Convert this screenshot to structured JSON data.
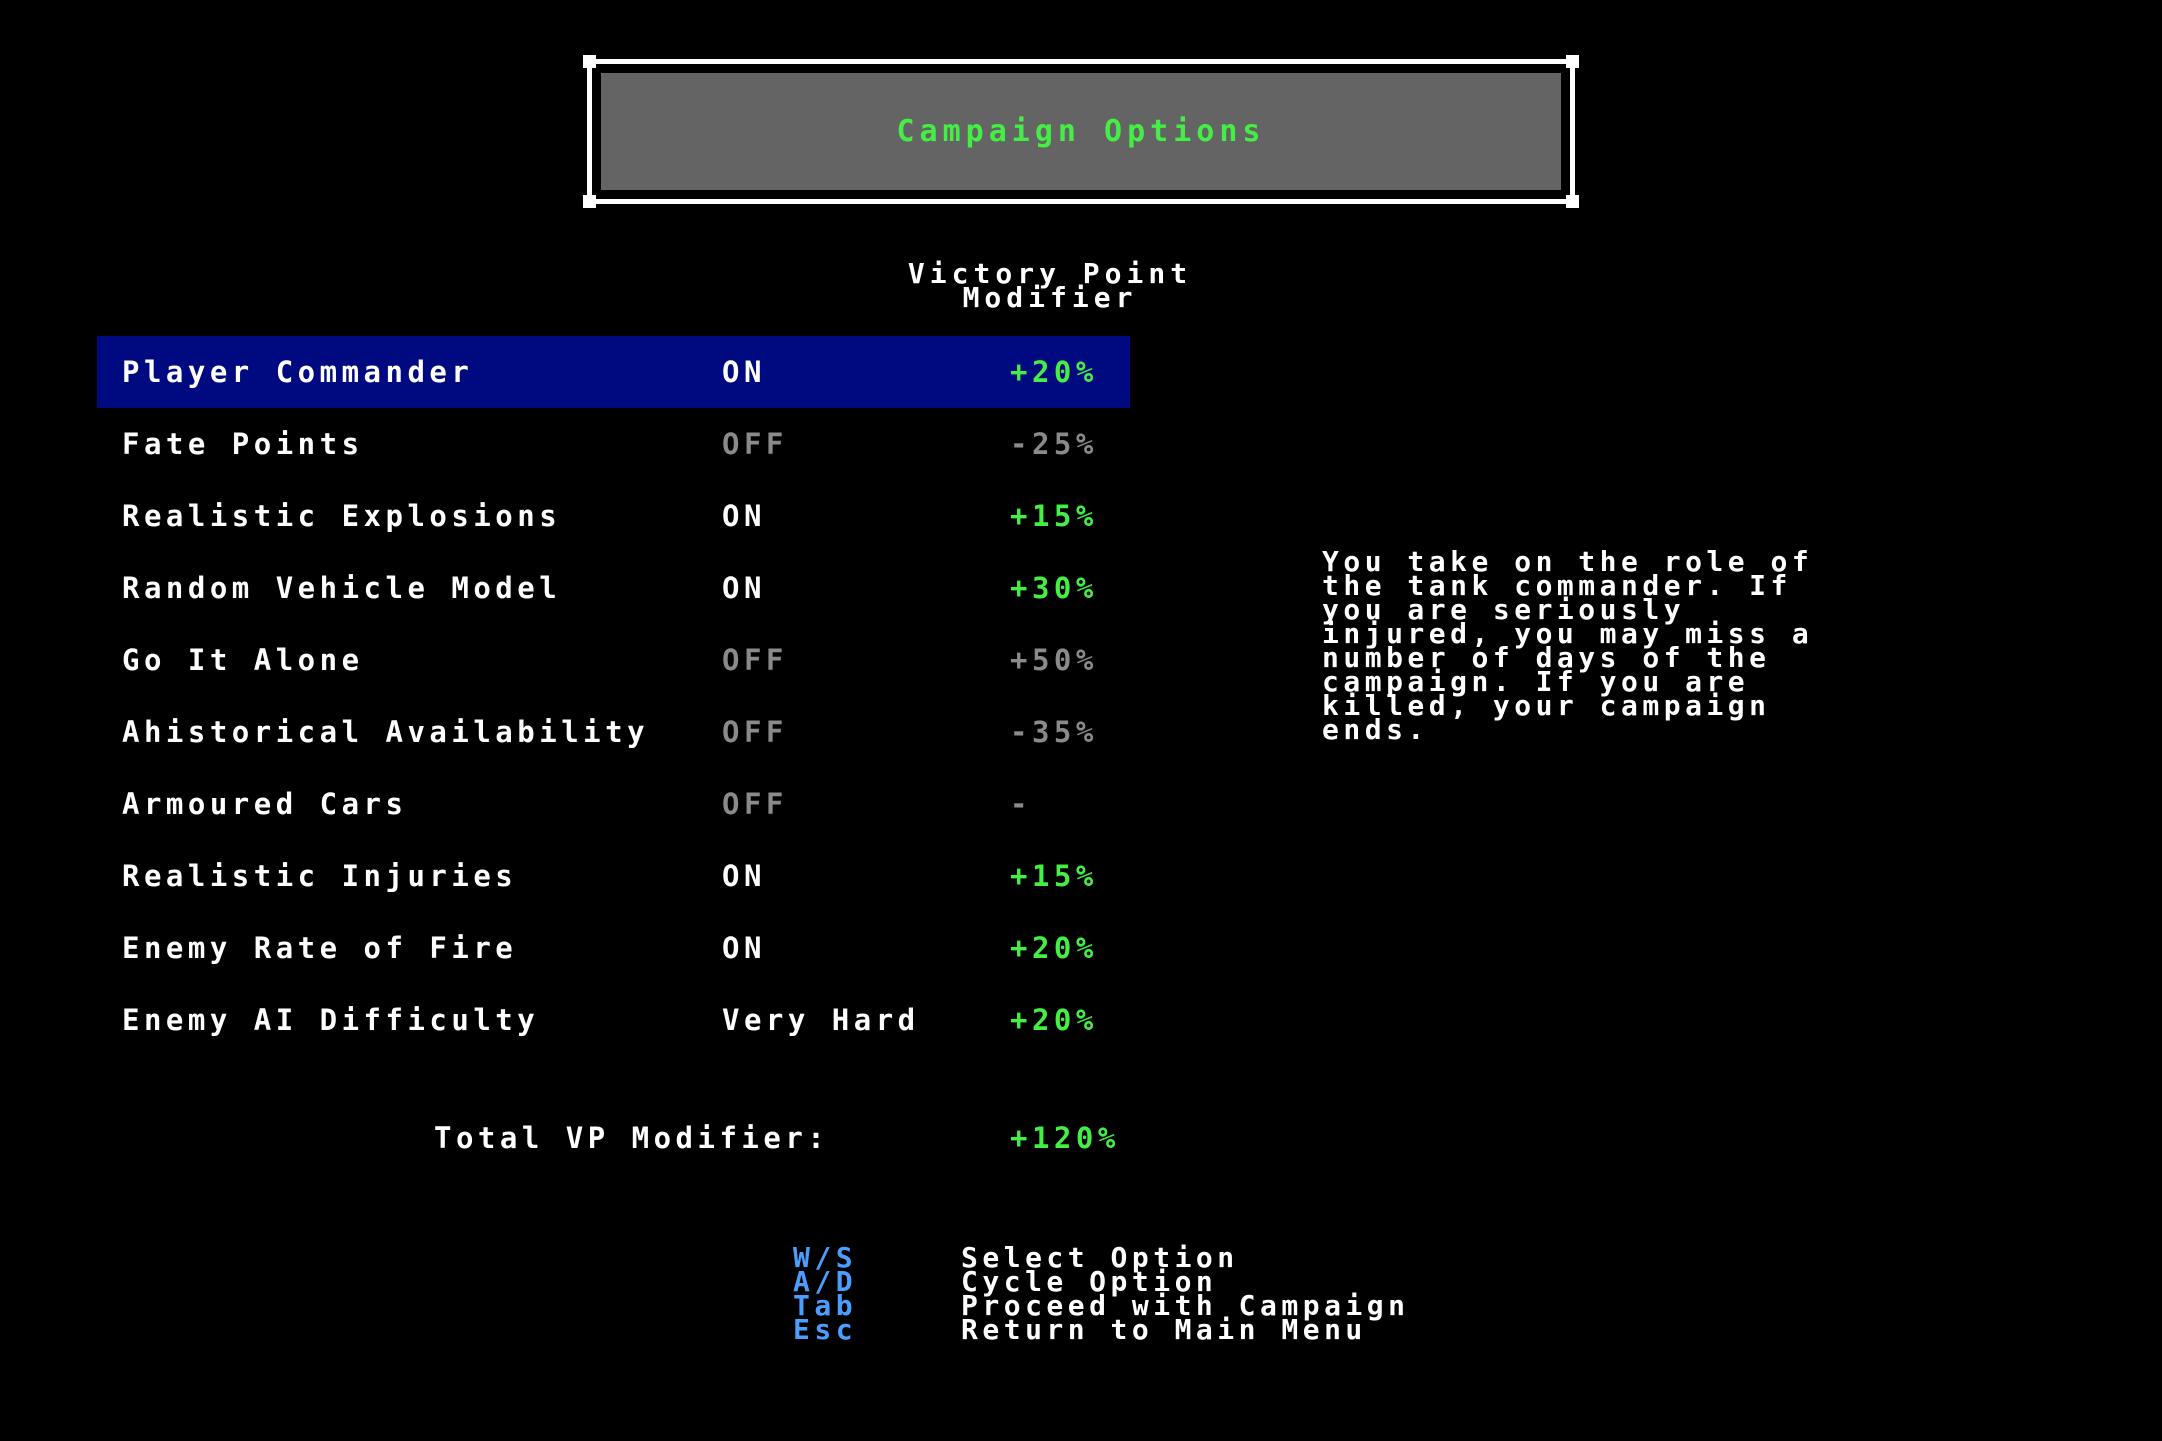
{
  "window": {
    "title": "Campaign Options"
  },
  "header": {
    "vp_line1": "Victory Point",
    "vp_line2": "Modifier"
  },
  "options": [
    {
      "label": "Player Commander",
      "state": "ON",
      "modifier": "+20%",
      "active": true,
      "selected": true
    },
    {
      "label": "Fate Points",
      "state": "OFF",
      "modifier": "-25%",
      "active": false,
      "selected": false
    },
    {
      "label": "Realistic Explosions",
      "state": "ON",
      "modifier": "+15%",
      "active": true,
      "selected": false
    },
    {
      "label": "Random Vehicle Model",
      "state": "ON",
      "modifier": "+30%",
      "active": true,
      "selected": false
    },
    {
      "label": "Go It Alone",
      "state": "OFF",
      "modifier": "+50%",
      "active": false,
      "selected": false
    },
    {
      "label": "Ahistorical Availability",
      "state": "OFF",
      "modifier": "-35%",
      "active": false,
      "selected": false
    },
    {
      "label": "Armoured Cars",
      "state": "OFF",
      "modifier": "-",
      "active": false,
      "selected": false
    },
    {
      "label": "Realistic Injuries",
      "state": "ON",
      "modifier": "+15%",
      "active": true,
      "selected": false
    },
    {
      "label": "Enemy Rate of Fire",
      "state": "ON",
      "modifier": "+20%",
      "active": true,
      "selected": false
    },
    {
      "label": "Enemy AI Difficulty",
      "state": "Very Hard",
      "modifier": "+20%",
      "active": true,
      "selected": false
    }
  ],
  "total": {
    "label": "Total VP Modifier:",
    "value": "+120%"
  },
  "description": {
    "text": "You take on the role of\nthe tank commander. If\nyou are seriously\ninjured, you may miss a\nnumber of days of the\ncampaign. If you are\nkilled, your campaign\nends."
  },
  "controls": [
    {
      "key": "W/S",
      "action": "Select Option"
    },
    {
      "key": "A/D",
      "action": "Cycle Option"
    },
    {
      "key": "Tab",
      "action": "Proceed with Campaign"
    },
    {
      "key": "Esc",
      "action": "Return to Main Menu"
    }
  ],
  "colors": {
    "background": "#000000",
    "title_box": "#646464",
    "title_text": "#44ee44",
    "selected_row": "#000a80",
    "active_modifier": "#44ee44",
    "inactive": "#8a8a8a",
    "key_hint": "#4a9eff"
  }
}
